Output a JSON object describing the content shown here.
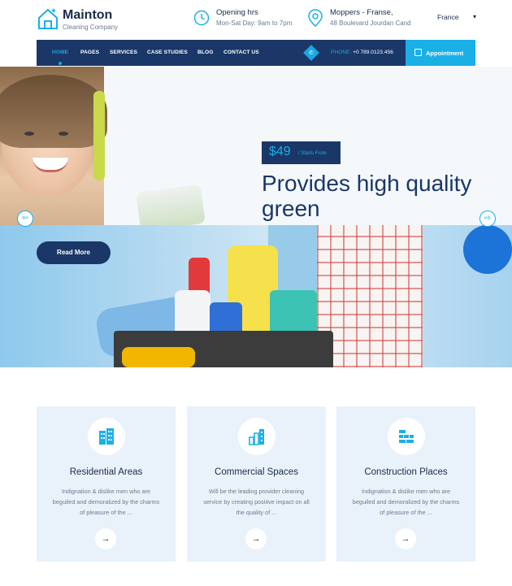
{
  "brand": {
    "name": "Mainton",
    "tagline": "Cleaning Company",
    "colors": {
      "navy": "#1a3768",
      "accent": "#1ab0e6",
      "card_bg": "#e9f2fa"
    }
  },
  "header": {
    "hours_title": "Opening hrs",
    "hours_text": "Mon-Sat Day: 9am to 7pm",
    "address_title": "Moppers - Franse,",
    "address_text": "48 Boulevard Jourdan Cand",
    "language": "France",
    "icons": {
      "hours": "clock-icon",
      "address": "map-pin-icon",
      "language_caret": "chevron-down-icon"
    }
  },
  "nav": {
    "items": [
      "HOME",
      "PAGES",
      "SERVICES",
      "CASE STUDIES",
      "BLOG",
      "CONTACT US"
    ],
    "active_index": 0,
    "phone_label": "PHONE:",
    "phone_number": "+0 789.0123.456",
    "appointment_label": "Appointment"
  },
  "hero": {
    "price": "$49",
    "price_suffix": "/ Starts From",
    "title": "Provides high quality green",
    "read_more": "Read More",
    "prev_arrow": "⇦",
    "next_arrow": "⇨"
  },
  "services": [
    {
      "title": "Residential Areas",
      "text": "Indignation & dislike men who are beguiled and demoralized by the charms of pleasure of the ...",
      "icon": "residential-building-icon",
      "arrow": "→"
    },
    {
      "title": "Commercial Spaces",
      "text": "Will be the leading provider cleaning service by creating positive impact on all the quality of ...",
      "icon": "commercial-building-icon",
      "arrow": "→"
    },
    {
      "title": "Construction Places",
      "text": "Indignation & dislike men who are beguiled and demoralized by the charms of pleasure of the ...",
      "icon": "construction-bricks-icon",
      "arrow": "→"
    }
  ]
}
